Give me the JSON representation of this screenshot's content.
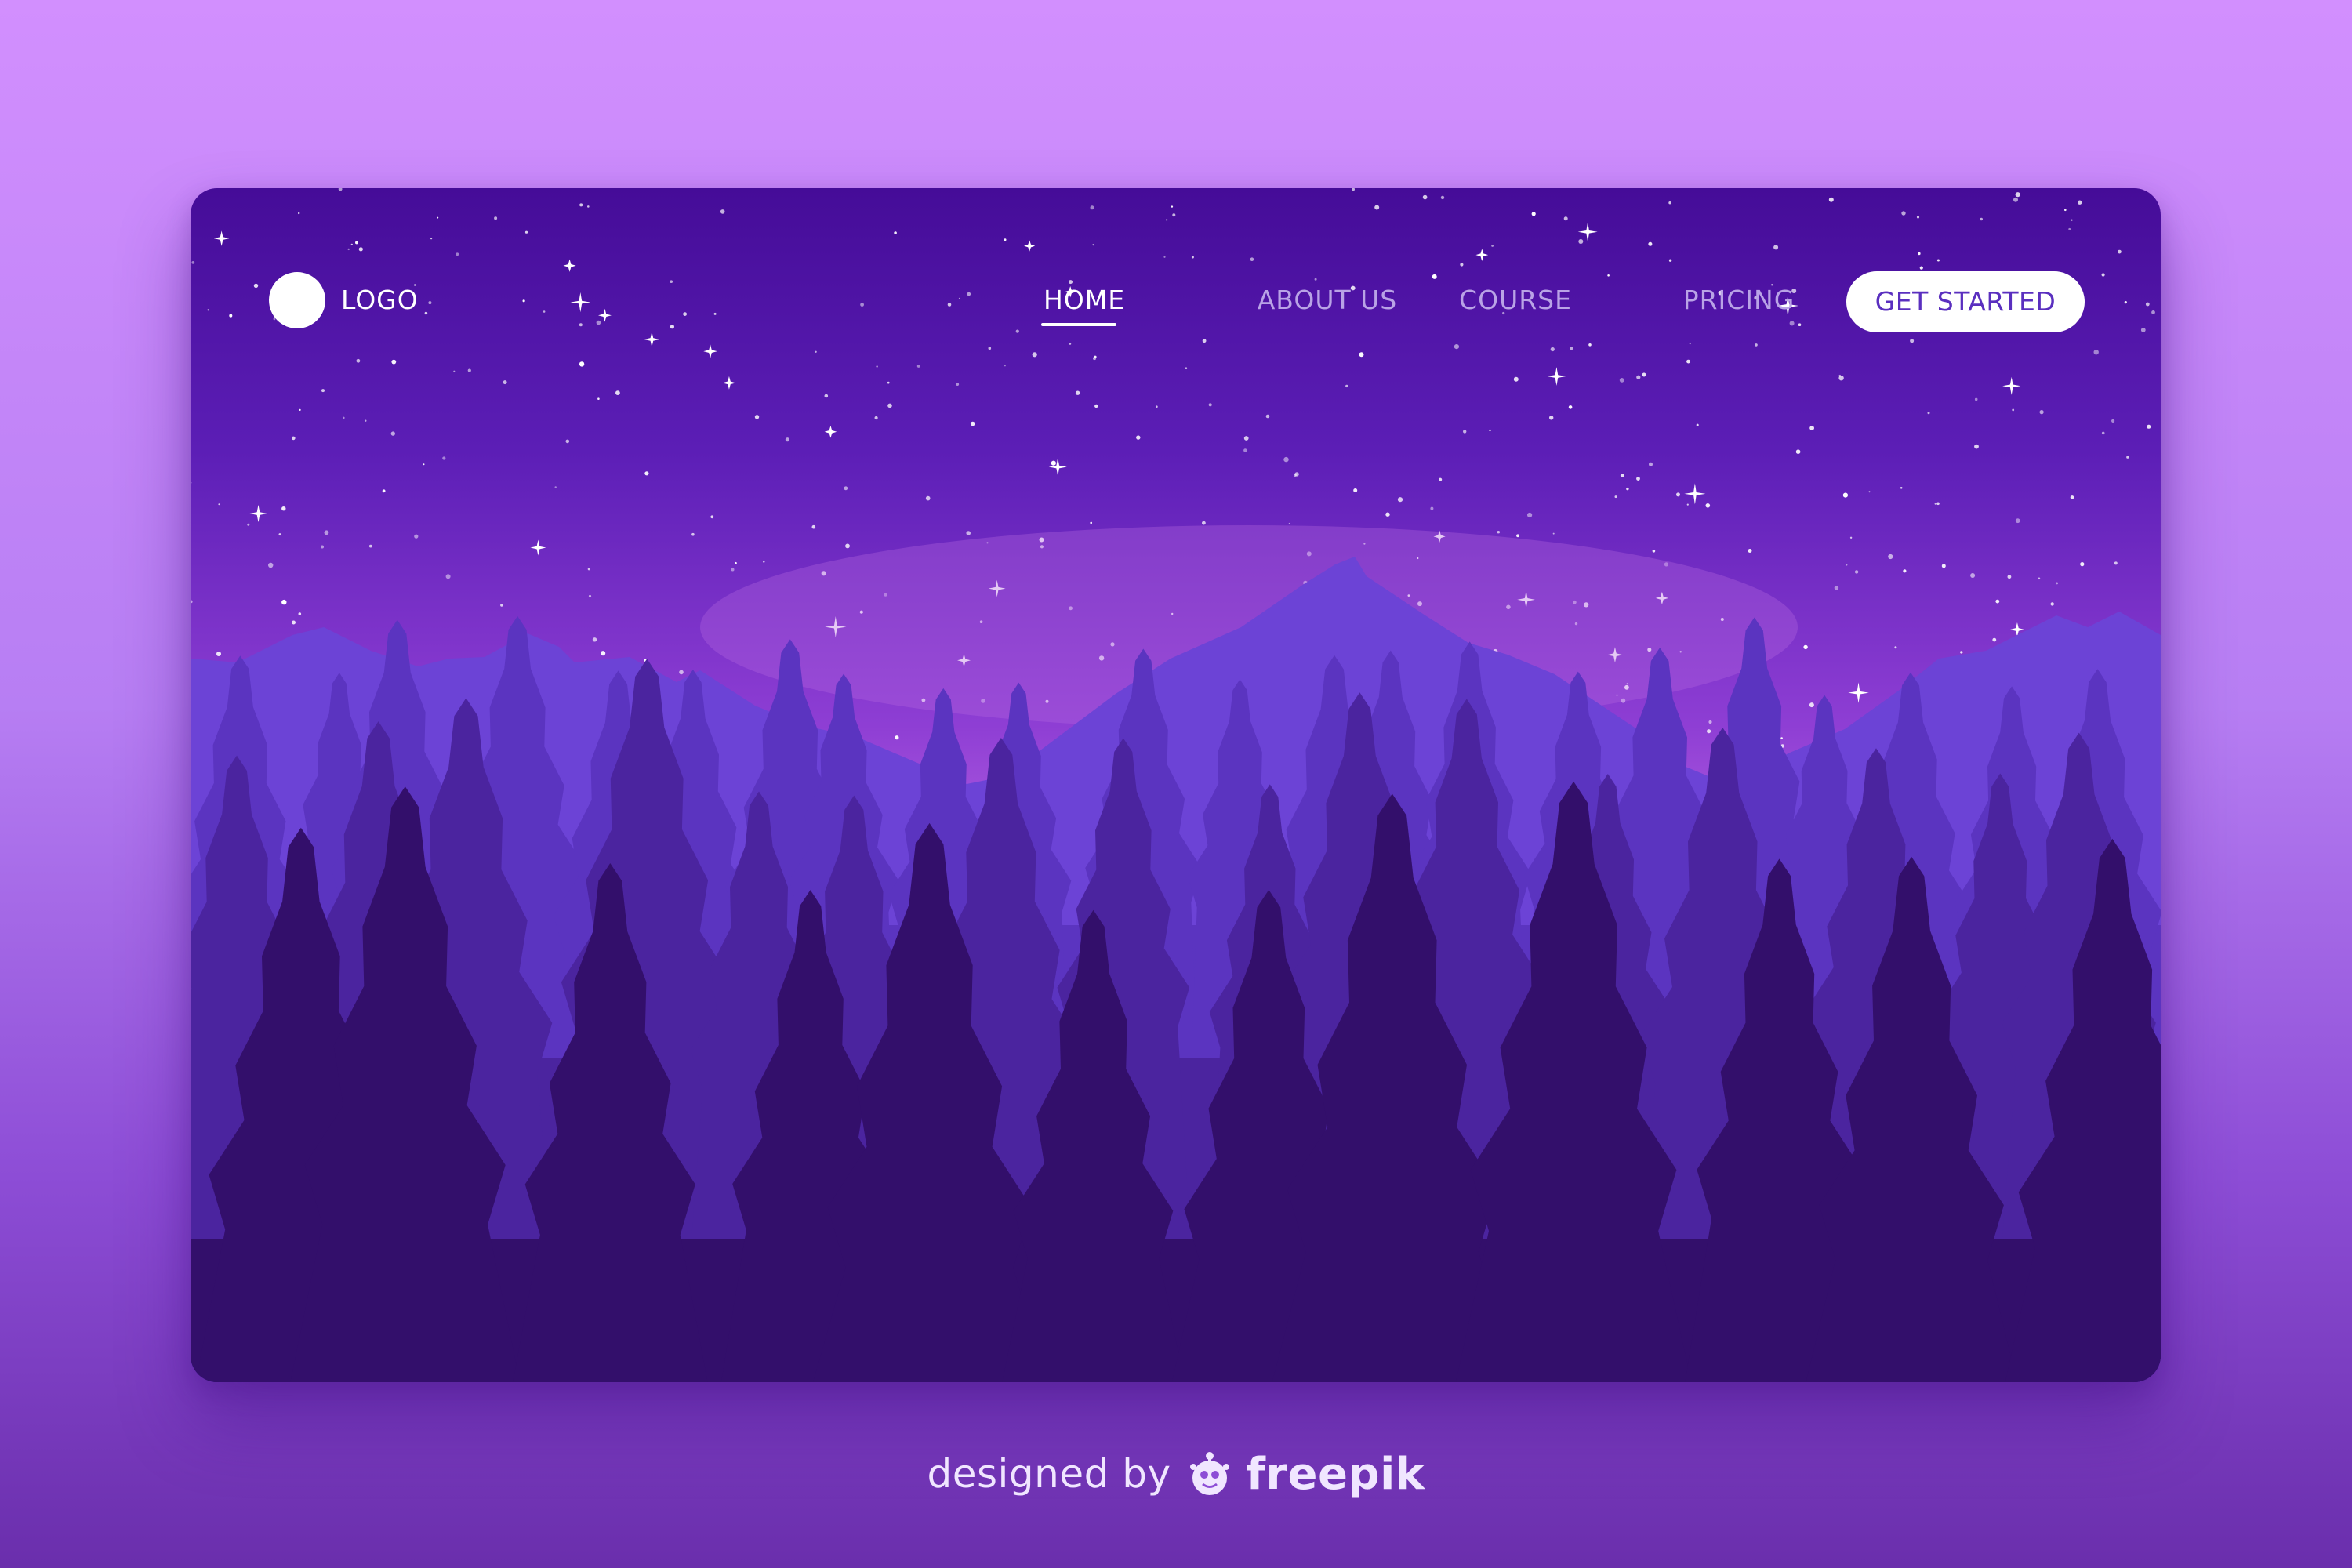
{
  "page": {
    "background_colors": [
      "#d28ffe",
      "#6a2eac"
    ]
  },
  "header": {
    "logo_text": "LOGO",
    "nav": {
      "home": "HOME",
      "about": "ABOUT US",
      "course": "COURSE",
      "pricing": "PRICING"
    },
    "active_item": "HOME",
    "cta_label": "GET STARTED"
  },
  "hero": {
    "scene": "starry-night-mountains-forest",
    "colors": {
      "sky_top": "#450c98",
      "sky_glow": "#c26de6",
      "mountains": "#6c43d6",
      "forest_far": "#5b34c0",
      "forest_mid": "#4b249f",
      "forest_near": "#330f6b"
    }
  },
  "credit": {
    "prefix": "designed by",
    "brand": "freepik",
    "icon": "freepik-logo-icon"
  }
}
